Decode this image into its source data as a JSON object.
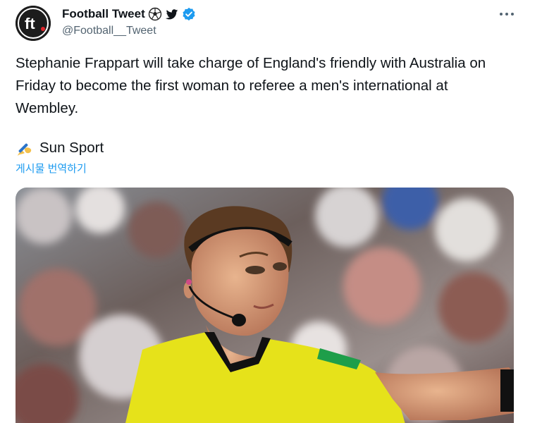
{
  "account": {
    "display_name": "Football Tweet",
    "handle": "@Football__Tweet",
    "avatar_text": "ft"
  },
  "tweet": {
    "text": "Stephanie Frappart will take charge of England's friendly with Australia on Friday to become the first woman to referee a men's international at Wembley.",
    "source": "Sun Sport",
    "translate_label": "게시물 번역하기"
  },
  "icons": {
    "name_emoji_1": "soccer-ball-icon",
    "name_emoji_2": "twitter-bird-icon",
    "verified": "verified-badge-icon",
    "more": "more-dots-icon",
    "source_emoji": "writing-hand-icon"
  },
  "colors": {
    "link": "#1d9bf0",
    "verified": "#1d9bf0",
    "referee_shirt": "#e6e21a",
    "text_primary": "#0f1419",
    "text_secondary": "#536471"
  }
}
